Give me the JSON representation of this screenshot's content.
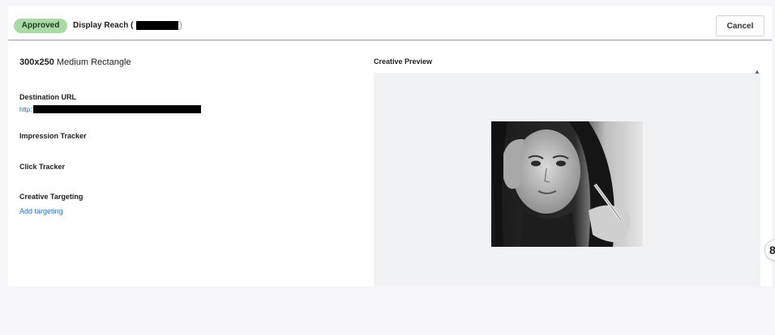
{
  "header": {
    "status_badge": "Approved",
    "campaign_name": "Display Reach (",
    "cancel_label": "Cancel"
  },
  "details": {
    "size_bold": "300x250",
    "size_name": "Medium Rectangle",
    "destination_url_label": "Destination URL",
    "destination_url_value": "http:",
    "impression_tracker_label": "Impression Tracker",
    "click_tracker_label": "Click Tracker",
    "creative_targeting_label": "Creative Targeting",
    "add_targeting_link": "Add targeting"
  },
  "preview": {
    "label": "Creative Preview",
    "scroll_up_glyph": "▲"
  },
  "side_widget": {
    "glyph": "8"
  },
  "colors": {
    "badge_bg": "#a8d9a7",
    "link": "#1a73c8",
    "preview_bg": "#f1f2f4"
  }
}
